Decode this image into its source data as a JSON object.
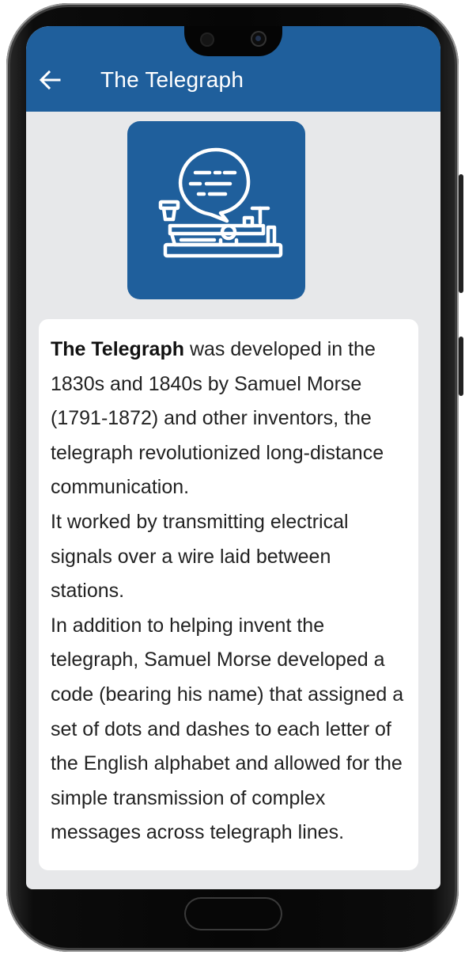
{
  "header": {
    "title": "The Telegraph",
    "back_icon": "arrow-left-icon",
    "background_color": "#1f5f9c"
  },
  "hero": {
    "icon": "telegraph-key-icon",
    "background_color": "#1f5f9c"
  },
  "article": {
    "lead": "The Telegraph",
    "intro_rest": " was developed in the 1830s and 1840s by Samuel Morse (1791-1872) and other inventors, the telegraph revolutionized long-distance communication.",
    "para2": "It worked by transmitting electrical signals over a wire laid between stations.",
    "para3": "In addition to helping invent the telegraph, Samuel Morse developed a code (bearing his name) that assigned a set of dots and dashes to each letter of the English alphabet and allowed for the simple transmission of complex messages across telegraph lines."
  }
}
